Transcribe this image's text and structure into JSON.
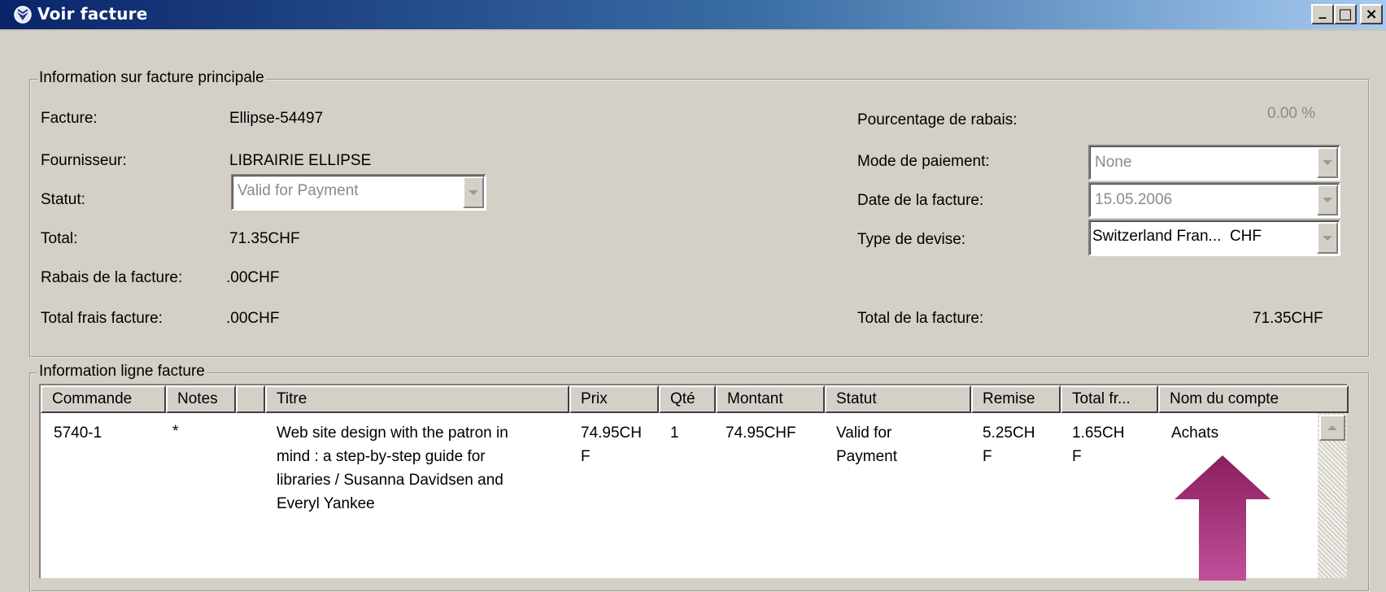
{
  "window": {
    "title": "Voir facture",
    "buttons": [
      "_",
      "□",
      "×"
    ]
  },
  "main_info": {
    "legend": "Information sur facture principale",
    "left": [
      {
        "label": "Facture:",
        "value": "Ellipse-54497"
      },
      {
        "label": "Fournisseur:",
        "value": "LIBRAIRIE ELLIPSE"
      },
      {
        "label": "Statut:",
        "value": "Valid for Payment"
      },
      {
        "label": "Total:",
        "value": "71.35CHF"
      },
      {
        "label": "Rabais de la facture:",
        "value": ".00CHF"
      },
      {
        "label": "Total frais facture:",
        "value": ".00CHF"
      }
    ],
    "right": [
      {
        "label": "Pourcentage de rabais:",
        "value": "0.00 %"
      },
      {
        "label": "Mode de paiement:",
        "value": "None"
      },
      {
        "label": "Date de la facture:",
        "value": "15.05.2006"
      },
      {
        "label": "Type de devise:",
        "value": "Switzerland Fran...  CHF"
      },
      {
        "label": "Total de la facture:",
        "value": "71.35CHF"
      }
    ]
  },
  "lines": {
    "legend": "Information ligne facture",
    "columns": [
      "Commande",
      "Notes",
      "",
      "Titre",
      "Prix",
      "Qté",
      "Montant",
      "Statut",
      "Remise",
      "Total fr...",
      "Nom du compte"
    ],
    "rows": [
      {
        "commande": "5740-1",
        "notes": "*",
        "titre": [
          "Web site design with the patron in",
          "mind : a step-by-step guide for",
          "libraries / Susanna Davidsen and",
          "Everyl Yankee"
        ],
        "prix": [
          "74.95CH",
          "F"
        ],
        "qte": "1",
        "montant": "74.95CHF",
        "statut": [
          "Valid for",
          "Payment"
        ],
        "remise": [
          "5.25CH",
          "F"
        ],
        "total_frais": [
          "1.65CH",
          "F"
        ],
        "nom_compte": "Achats"
      }
    ]
  },
  "annotation_arrow_color": "#9b2a72"
}
